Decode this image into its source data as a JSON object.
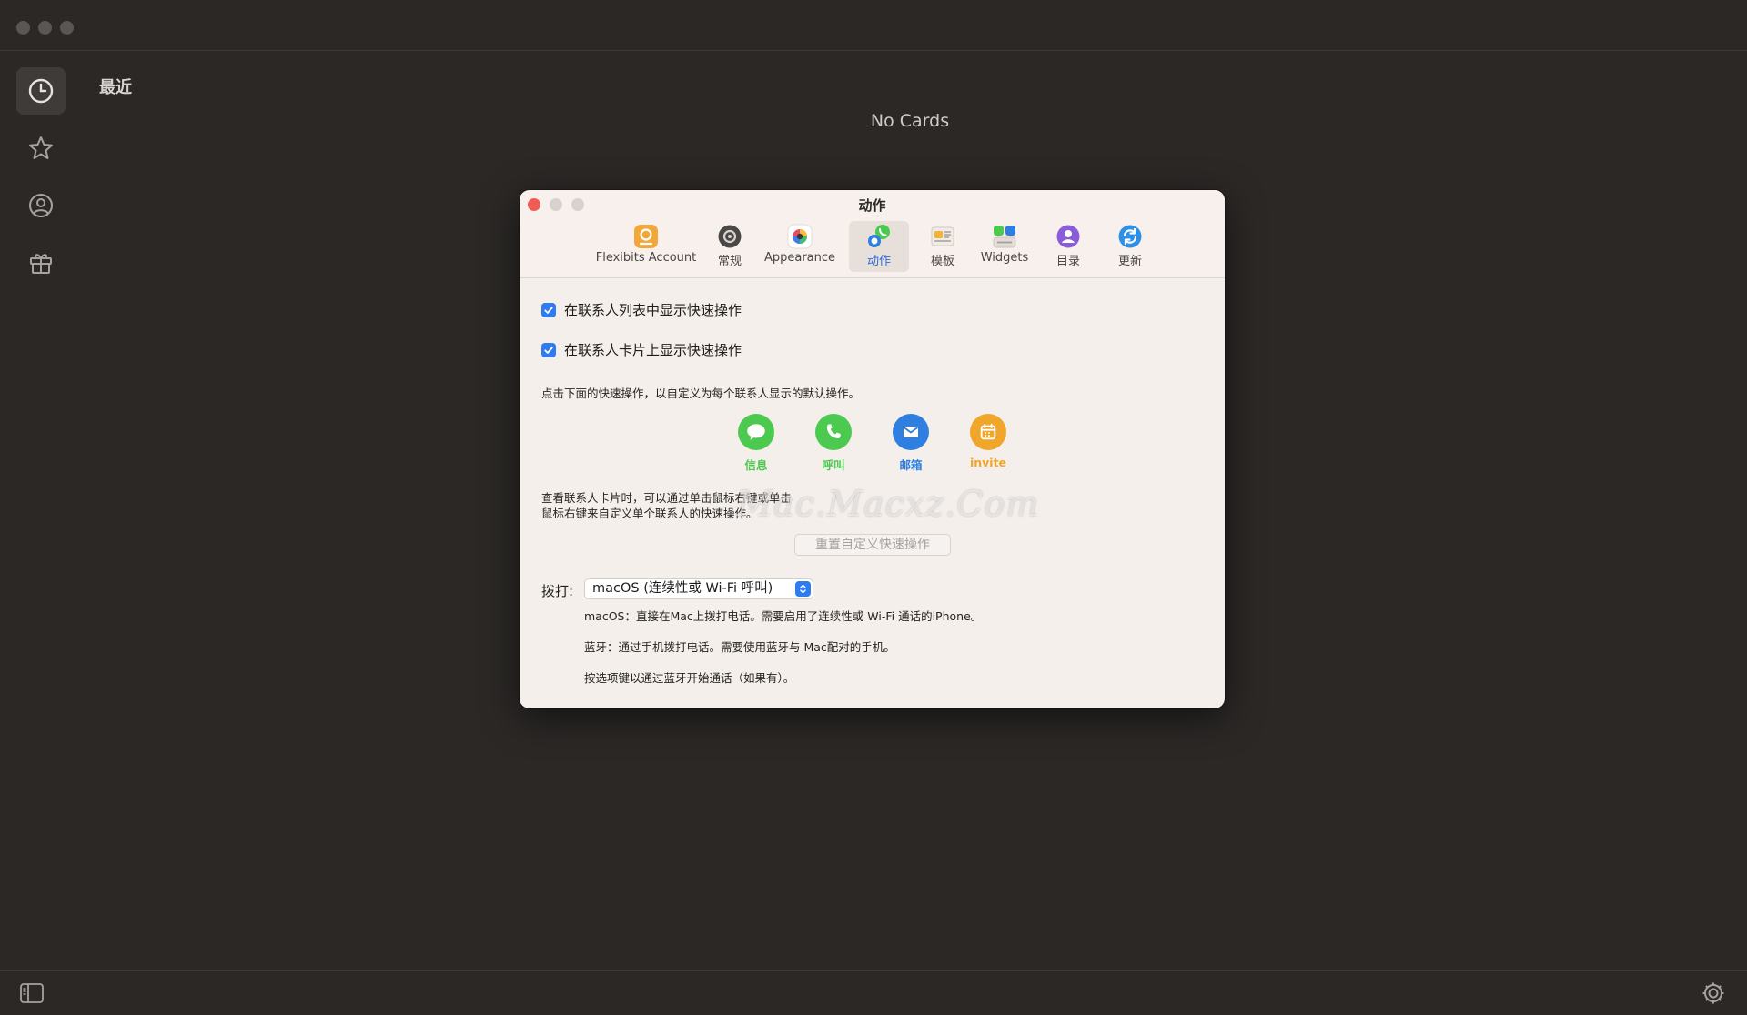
{
  "sidebar": {
    "items": [
      {
        "name": "recent",
        "icon": "clock-icon"
      },
      {
        "name": "favorites",
        "icon": "star-icon"
      },
      {
        "name": "contacts",
        "icon": "person-circle-icon"
      },
      {
        "name": "gifts",
        "icon": "gift-icon"
      }
    ]
  },
  "main": {
    "section_title": "最近",
    "empty_state": "No Cards"
  },
  "dialog": {
    "title": "动作",
    "tabs": [
      {
        "label": "Flexibits Account",
        "icon": "account-icon"
      },
      {
        "label": "常规",
        "icon": "general-icon"
      },
      {
        "label": "Appearance",
        "icon": "appearance-icon"
      },
      {
        "label": "动作",
        "icon": "actions-icon",
        "active": true
      },
      {
        "label": "模板",
        "icon": "templates-icon"
      },
      {
        "label": "Widgets",
        "icon": "widgets-icon"
      },
      {
        "label": "目录",
        "icon": "directory-icon"
      },
      {
        "label": "更新",
        "icon": "update-icon"
      }
    ],
    "checkbox1": "在联系人列表中显示快速操作",
    "checkbox2": "在联系人卡片上显示快速操作",
    "instructions": "点击下面的快速操作，以自定义为每个联系人显示的默认操作。",
    "actions": [
      {
        "label": "信息",
        "color": "#4cc94f",
        "icon": "message-icon"
      },
      {
        "label": "呼叫",
        "color": "#4cc94f",
        "icon": "phone-icon"
      },
      {
        "label": "邮箱",
        "color": "#2e7fe0",
        "icon": "mail-icon"
      },
      {
        "label": "invite",
        "color": "#f0a62a",
        "icon": "calendar-icon"
      }
    ],
    "card_hint_line1": "查看联系人卡片时，可以通过单击鼠标右键或单击",
    "card_hint_line2": "鼠标右键来自定义单个联系人的快速操作。",
    "reset_button": "重置自定义快速操作",
    "dial_label": "拨打:",
    "dial_value": "macOS (连续性或 Wi-Fi 呼叫)",
    "note_macos": "macOS：直接在Mac上拨打电话。需要启用了连续性或 Wi-Fi 通话的iPhone。",
    "note_bluetooth": "蓝牙：通过手机拨打电话。需要使用蓝牙与 Mac配对的手机。",
    "note_option": "按选项键以通过蓝牙开始通话（如果有）。"
  },
  "watermark": "Mac.Macxz.Com",
  "colors": {
    "accent": "#2f7bf0",
    "green": "#4cc94f",
    "orange": "#f0a62a",
    "background": "#2b2826",
    "dialog": "#f4efeb"
  }
}
